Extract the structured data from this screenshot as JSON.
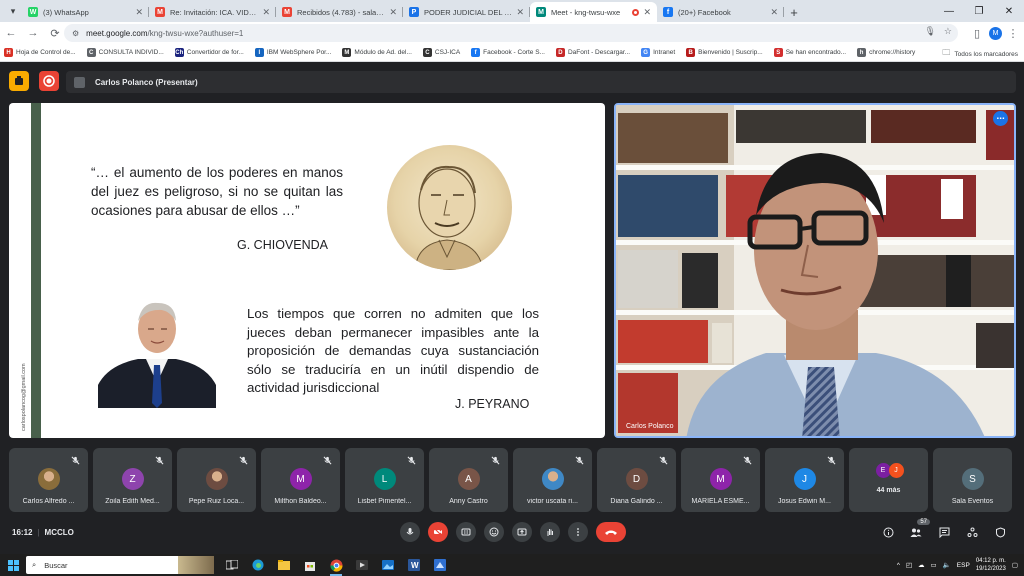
{
  "browser": {
    "tabs": [
      {
        "title": "(3) WhatsApp",
        "color": "#25d366",
        "glyph": "W"
      },
      {
        "title": "Re: Invitación: ICA. VIDEOCONFE",
        "color": "#ea4335",
        "glyph": "M"
      },
      {
        "title": "Recibidos (4.783) - salaeventos",
        "color": "#ea4335",
        "glyph": "M"
      },
      {
        "title": "PODER JUDICIAL DEL PERU - CAI",
        "color": "#1a73e8",
        "glyph": "P"
      },
      {
        "title": "Meet - kng-twsu-wxe",
        "color": "#00897b",
        "glyph": "M",
        "active": true
      },
      {
        "title": "(20+) Facebook",
        "color": "#1877f2",
        "glyph": "f"
      }
    ],
    "url": "meet.google.com/kng-twsu-wxe?authuser=1",
    "url_host": "meet.google.com",
    "url_path": "/kng-twsu-wxe?authuser=1",
    "profile_initial": "M",
    "bookmarks": [
      {
        "label": "Hoja de Control de...",
        "color": "#d93025",
        "glyph": "H"
      },
      {
        "label": "CONSULTA INDIVID...",
        "color": "#5f6368",
        "glyph": "C"
      },
      {
        "label": "Convertidor de for...",
        "color": "#1a237e",
        "glyph": "Ch"
      },
      {
        "label": "IBM WebSphere Por...",
        "color": "#1565c0",
        "glyph": "I"
      },
      {
        "label": "Módulo de Ad. del...",
        "color": "#333333",
        "glyph": "M"
      },
      {
        "label": "CSJ-ICA",
        "color": "#333333",
        "glyph": "C"
      },
      {
        "label": "Facebook - Corte S...",
        "color": "#1877f2",
        "glyph": "f"
      },
      {
        "label": "DaFont - Descargar...",
        "color": "#c62828",
        "glyph": "D"
      },
      {
        "label": "Intranet",
        "color": "#4285f4",
        "glyph": "G"
      },
      {
        "label": "Bienvenido | Suscrip...",
        "color": "#b71c1c",
        "glyph": "B"
      },
      {
        "label": "Se han encontrado...",
        "color": "#d32f2f",
        "glyph": "S"
      },
      {
        "label": "chrome://history",
        "color": "#5f6368",
        "glyph": "h"
      }
    ],
    "bookmarks_folder": "Todos los marcadores"
  },
  "meet": {
    "presenter_label": "Carlos Polanco (Presentar)",
    "slide": {
      "quote1": "“… el aumento de los poderes en manos del juez es peligroso, si no se quitan las ocasiones para abusar de ellos …”",
      "author1": "G. CHIOVENDA",
      "quote2": "Los tiempos que corren no admiten que los jueces deban permanecer impasibles ante la proposición de demandas cuya sustanciación sólo se traduciría en un inútil dispendio de actividad jurisdiccional",
      "author2": "J. PEYRANO",
      "email": "carlospolancog@gmail.com"
    },
    "camera_name": "Carlos Polanco",
    "participants": [
      {
        "name": "Carlos Alfredo ...",
        "initial": "",
        "color": "#8a6d3b",
        "photo": true
      },
      {
        "name": "Zoila Edith Med...",
        "initial": "Z",
        "color": "#8e44ad"
      },
      {
        "name": "Pepe Ruiz Loca...",
        "initial": "",
        "color": "#6d4c41",
        "photo": true
      },
      {
        "name": "Milthon Baldeo...",
        "initial": "M",
        "color": "#8e24aa"
      },
      {
        "name": "Lisbet Pimentel...",
        "initial": "L",
        "color": "#00897b"
      },
      {
        "name": "Anny Castro",
        "initial": "A",
        "color": "#795548"
      },
      {
        "name": "victor uscata ri...",
        "initial": "",
        "color": "#3f88c5",
        "photo": true
      },
      {
        "name": "Diana Galindo ...",
        "initial": "D",
        "color": "#6d4c41"
      },
      {
        "name": "MARIELA ESME...",
        "initial": "M",
        "color": "#8e24aa"
      },
      {
        "name": "Josus Edwin M...",
        "initial": "J",
        "color": "#1e88e5"
      }
    ],
    "more_tile": {
      "label": "44 más",
      "initials": [
        "E",
        "J"
      ],
      "colors": [
        "#7b1fa2",
        "#f4511e"
      ]
    },
    "room_tile": {
      "name": "Sala Eventos",
      "initial": "S",
      "color": "#546e7a"
    },
    "time": "16:12",
    "meeting_code": "MCCLO",
    "people_count": "57"
  },
  "taskbar": {
    "search_placeholder": "Buscar",
    "lang": "ESP",
    "time": "04:12 p. m.",
    "date": "19/12/2023"
  }
}
